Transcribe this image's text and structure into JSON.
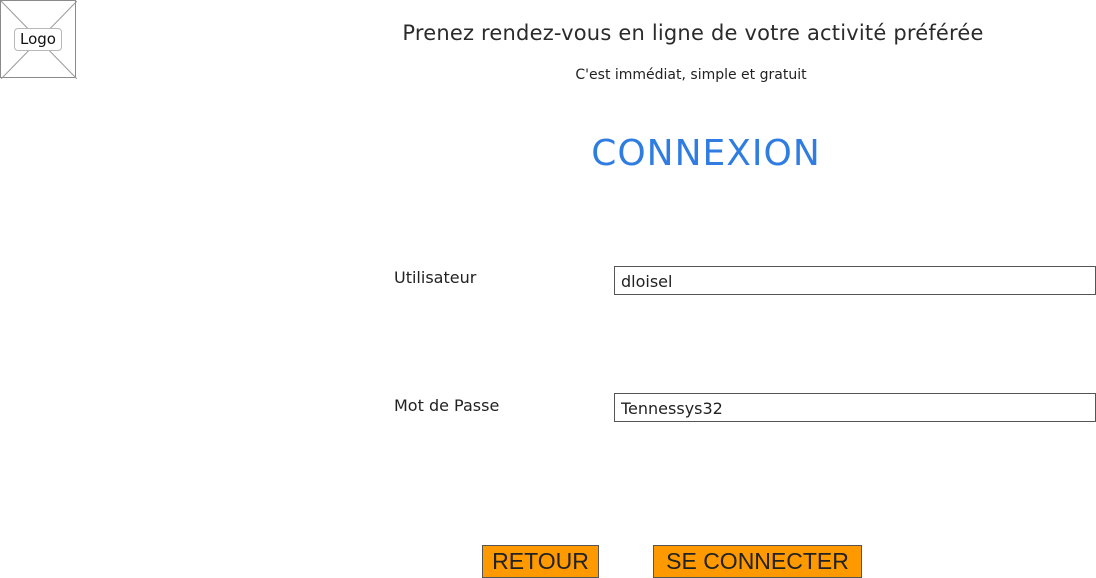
{
  "header": {
    "logo_label": "Logo",
    "headline": "Prenez rendez-vous en ligne de votre activité préférée",
    "subline": "C'est immédiat, simple et gratuit"
  },
  "login": {
    "title": "CONNEXION",
    "user_label": "Utilisateur",
    "user_value": "dloisel",
    "password_label": "Mot de Passe",
    "password_value": "Tennessys32"
  },
  "actions": {
    "back_label": "RETOUR",
    "connect_label": "SE CONNECTER"
  },
  "colors": {
    "accent": "#2f7de1",
    "button": "#ff9900"
  }
}
